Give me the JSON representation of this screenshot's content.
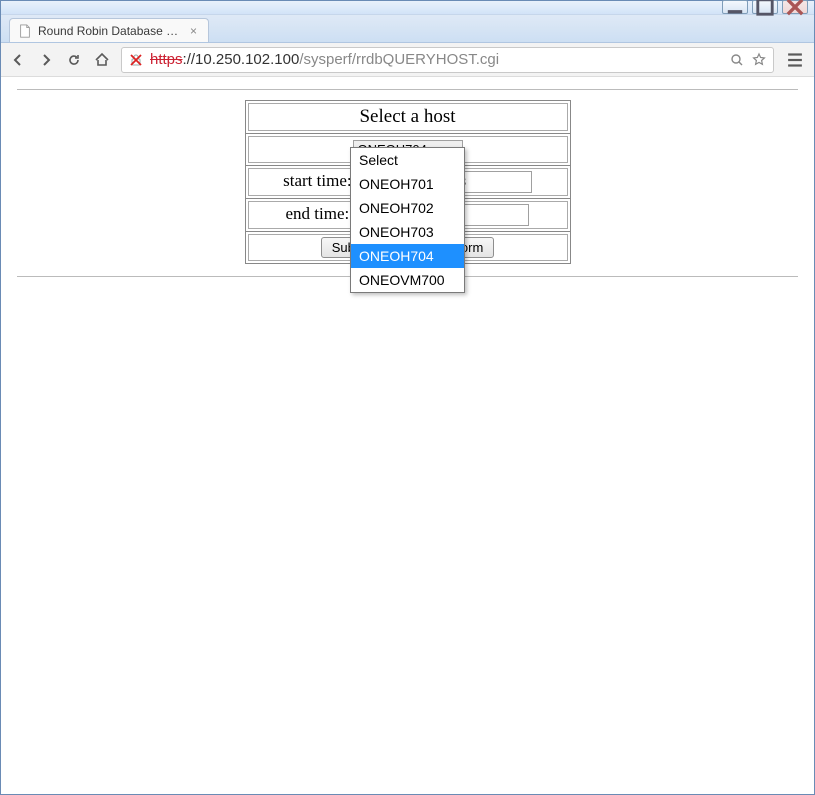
{
  "window": {
    "tab_title": "Round Robin Database Q…",
    "url_scheme": "https",
    "url_host": "://10.250.102.100",
    "url_path": "/sysperf/rrdbQUERYHOST.cgi"
  },
  "form": {
    "header": "Select a host",
    "selected_host": "ONEOH704",
    "start_label": "start time:",
    "start_value": "07/31/2014 10:13",
    "start_value_visible_suffix": "0:13",
    "end_label": "end time:",
    "end_value": "07/31/2014 13:10",
    "end_value_visible_suffix": "3:10",
    "submit_label": "Submit",
    "submit_label_visible": "Subm",
    "reset_label": "Reset Form",
    "reset_label_visible": "Form"
  },
  "dropdown": {
    "options": [
      {
        "label": "Select"
      },
      {
        "label": "ONEOH701"
      },
      {
        "label": "ONEOH702"
      },
      {
        "label": "ONEOH703"
      },
      {
        "label": "ONEOH704",
        "highlight": true
      },
      {
        "label": "ONEOVM700"
      }
    ]
  }
}
